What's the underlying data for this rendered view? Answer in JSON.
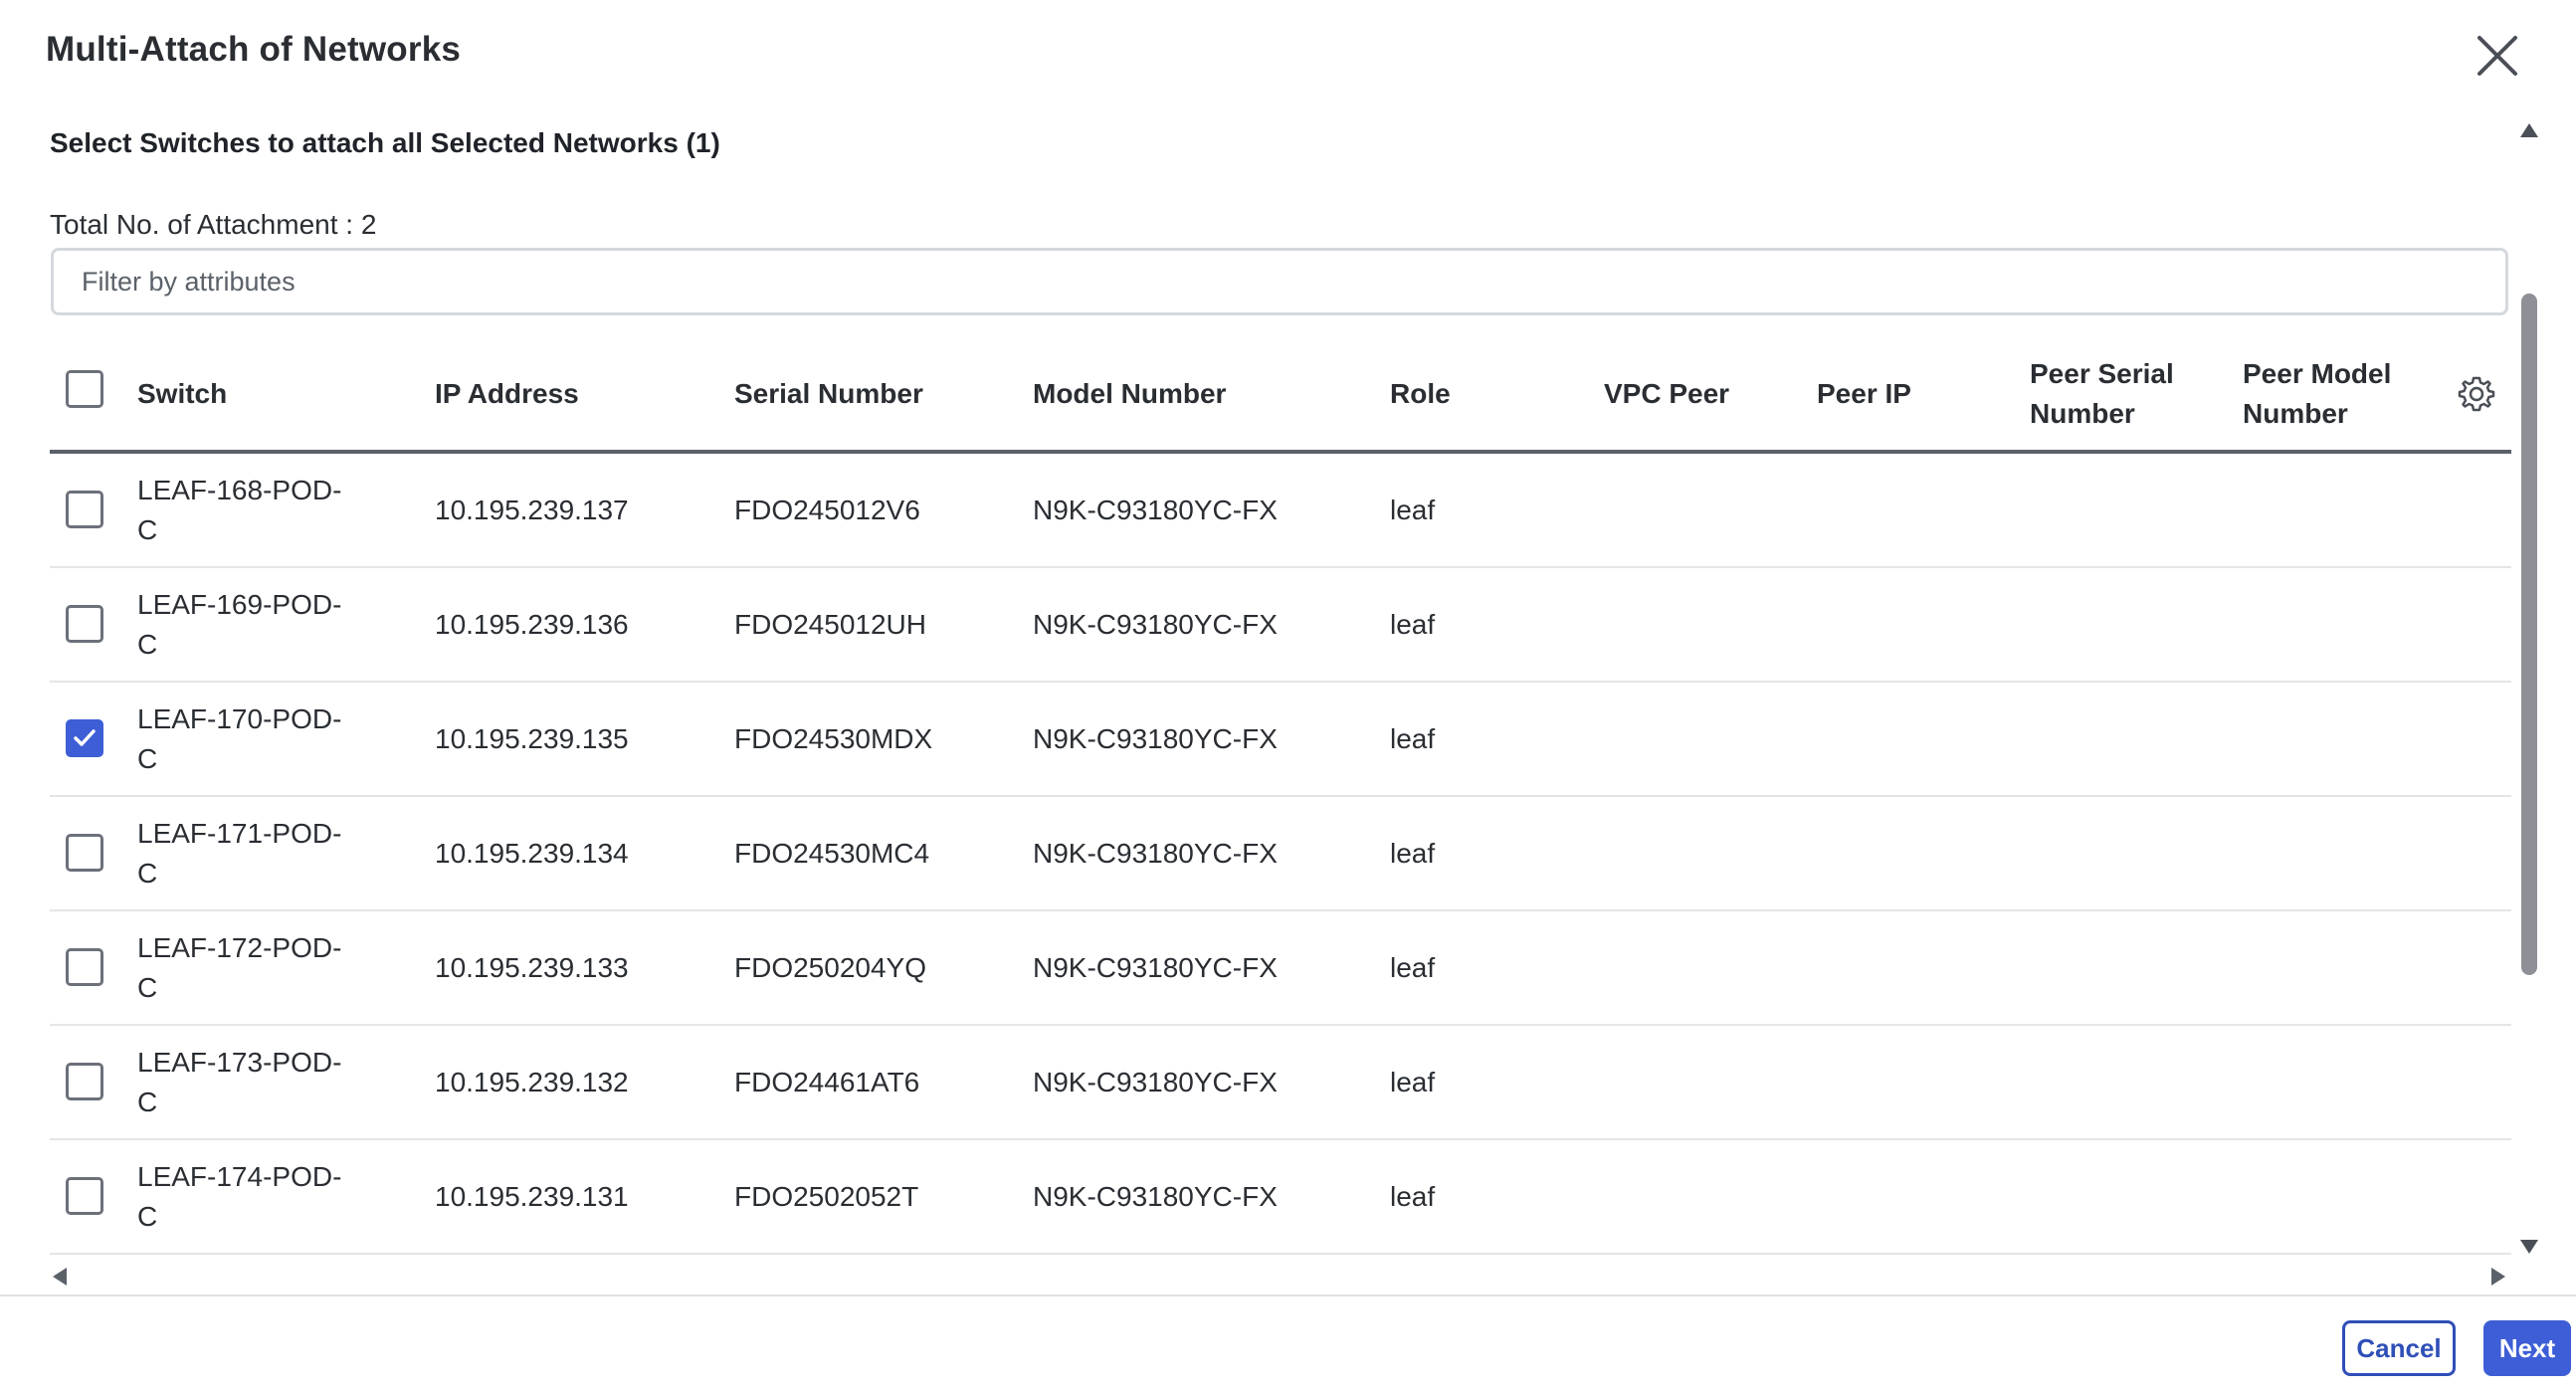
{
  "dialog": {
    "title": "Multi-Attach of Networks",
    "subtitle": "Select Switches to attach all Selected Networks (1)",
    "total_attachment": "Total No. of Attachment : 2",
    "filter_placeholder": "Filter by attributes",
    "close_icon": "close-icon"
  },
  "table": {
    "columns": {
      "switch": "Switch",
      "ip": "IP Address",
      "serial": "Serial Number",
      "model": "Model Number",
      "role": "Role",
      "vpc_peer": "VPC Peer",
      "peer_ip": "Peer IP",
      "peer_serial_1": "Peer Serial",
      "peer_serial_2": "Number",
      "peer_model_1": "Peer Model",
      "peer_model_2": "Number"
    },
    "settings_icon": "gear-icon",
    "header_checked": false,
    "rows": [
      {
        "switch_1": "LEAF-168-POD-",
        "switch_2": "C",
        "ip": "10.195.239.137",
        "serial": "FDO245012V6",
        "model": "N9K-C93180YC-FX",
        "role": "leaf",
        "checked": false
      },
      {
        "switch_1": "LEAF-169-POD-",
        "switch_2": "C",
        "ip": "10.195.239.136",
        "serial": "FDO245012UH",
        "model": "N9K-C93180YC-FX",
        "role": "leaf",
        "checked": false
      },
      {
        "switch_1": "LEAF-170-POD-",
        "switch_2": "C",
        "ip": "10.195.239.135",
        "serial": "FDO24530MDX",
        "model": "N9K-C93180YC-FX",
        "role": "leaf",
        "checked": true
      },
      {
        "switch_1": "LEAF-171-POD-",
        "switch_2": "C",
        "ip": "10.195.239.134",
        "serial": "FDO24530MC4",
        "model": "N9K-C93180YC-FX",
        "role": "leaf",
        "checked": false
      },
      {
        "switch_1": "LEAF-172-POD-",
        "switch_2": "C",
        "ip": "10.195.239.133",
        "serial": "FDO250204YQ",
        "model": "N9K-C93180YC-FX",
        "role": "leaf",
        "checked": false
      },
      {
        "switch_1": "LEAF-173-POD-",
        "switch_2": "C",
        "ip": "10.195.239.132",
        "serial": "FDO24461AT6",
        "model": "N9K-C93180YC-FX",
        "role": "leaf",
        "checked": false
      },
      {
        "switch_1": "LEAF-174-POD-",
        "switch_2": "C",
        "ip": "10.195.239.131",
        "serial": "FDO2502052T",
        "model": "N9K-C93180YC-FX",
        "role": "leaf",
        "checked": false
      }
    ]
  },
  "footer": {
    "cancel_label": "Cancel",
    "next_label": "Next"
  },
  "colors": {
    "accent": "#3d5ed6",
    "cancel_border": "#2f4fb8"
  }
}
